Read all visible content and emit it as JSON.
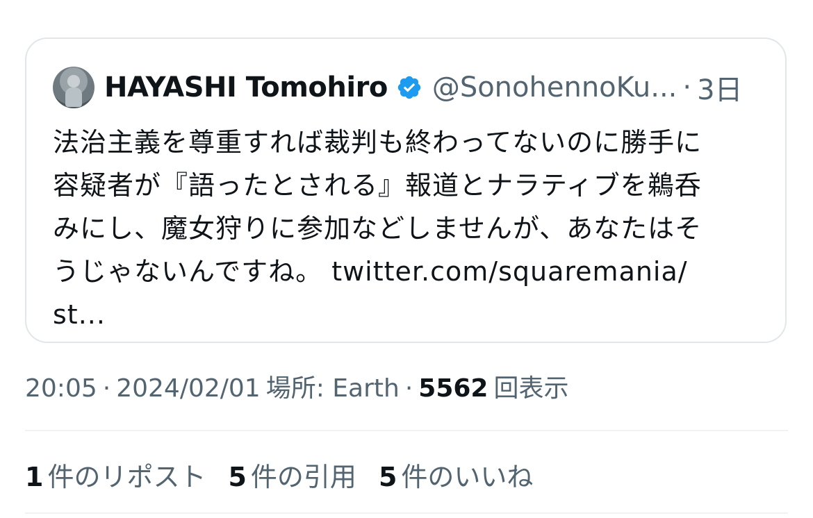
{
  "quoted_tweet": {
    "author": {
      "display_name": "HAYASHI Tomohiro",
      "handle": "@SonohennoKu...",
      "verified": true,
      "avatar_icon": "profile-photo"
    },
    "separator": "·",
    "age": "3日",
    "text_lines": [
      "法治主義を尊重すれば裁判も終わってないのに勝手に",
      "容疑者が『語ったとされる』報道とナラティブを鵜呑",
      "みにし、魔女狩りに参加などしませんが、あなたはそ",
      "うじゃないんですね。",
      "st..."
    ],
    "link_text": "twitter.com/squaremania/"
  },
  "meta": {
    "time": "20:05",
    "date": "2024/02/01",
    "location": "場所: Earth",
    "separator": "·",
    "views_count": "5562",
    "views_label": "回表示"
  },
  "stats": [
    {
      "count": "1",
      "label": "件のリポスト"
    },
    {
      "count": "5",
      "label": "件の引用"
    },
    {
      "count": "5",
      "label": "件のいいね"
    }
  ],
  "colors": {
    "text_primary": "#0f1419",
    "text_secondary": "#536471",
    "verified_blue": "#1d9bf0",
    "border": "#e1e6ea"
  }
}
